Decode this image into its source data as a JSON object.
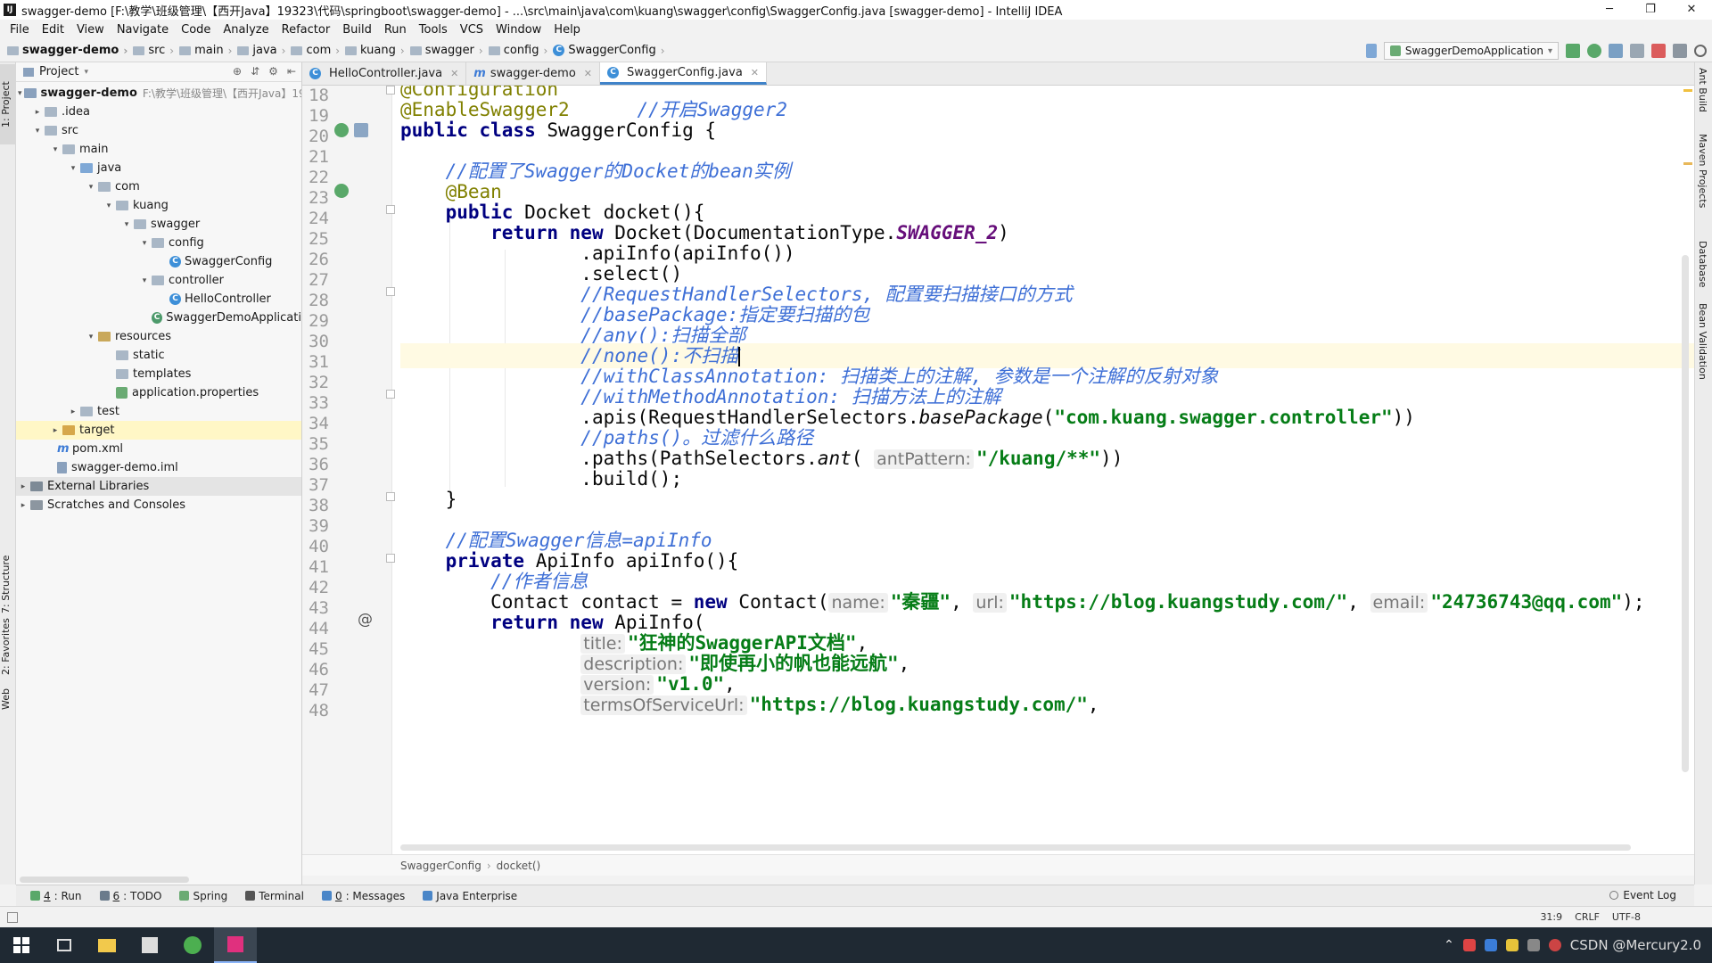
{
  "window": {
    "title": "swagger-demo [F:\\教学\\班级管理\\【西开Java】19323\\代码\\springboot\\swagger-demo] - ...\\src\\main\\java\\com\\kuang\\swagger\\config\\SwaggerConfig.java [swagger-demo] - IntelliJ IDEA",
    "minimize": "─",
    "maximize": "❐",
    "close": "✕"
  },
  "menu": [
    "File",
    "Edit",
    "View",
    "Navigate",
    "Code",
    "Analyze",
    "Refactor",
    "Build",
    "Run",
    "Tools",
    "VCS",
    "Window",
    "Help"
  ],
  "breadcrumbs": [
    "swagger-demo",
    "src",
    "main",
    "java",
    "com",
    "kuang",
    "swagger",
    "config",
    "SwaggerConfig"
  ],
  "run_config": "SwaggerDemoApplication",
  "project_panel": {
    "title": "Project",
    "tree": [
      {
        "label": "swagger-demo",
        "extra": "F:\\教学\\班级管理\\【西开Java】19",
        "arrow": "▾"
      },
      {
        "label": ".idea",
        "arrow": "▸"
      },
      {
        "label": "src",
        "arrow": "▾"
      },
      {
        "label": "main",
        "arrow": "▾"
      },
      {
        "label": "java",
        "arrow": "▾"
      },
      {
        "label": "com",
        "arrow": "▾"
      },
      {
        "label": "kuang",
        "arrow": "▾"
      },
      {
        "label": "swagger",
        "arrow": "▾"
      },
      {
        "label": "config",
        "arrow": "▾"
      },
      {
        "label": "SwaggerConfig",
        "arrow": ""
      },
      {
        "label": "controller",
        "arrow": "▾"
      },
      {
        "label": "HelloController",
        "arrow": ""
      },
      {
        "label": "SwaggerDemoApplicati",
        "arrow": ""
      },
      {
        "label": "resources",
        "arrow": "▾"
      },
      {
        "label": "static",
        "arrow": ""
      },
      {
        "label": "templates",
        "arrow": ""
      },
      {
        "label": "application.properties",
        "arrow": ""
      },
      {
        "label": "test",
        "arrow": "▸"
      },
      {
        "label": "target",
        "arrow": "▸"
      },
      {
        "label": "pom.xml",
        "arrow": ""
      },
      {
        "label": "swagger-demo.iml",
        "arrow": ""
      },
      {
        "label": "External Libraries",
        "arrow": "▸"
      },
      {
        "label": "Scratches and Consoles",
        "arrow": "▸"
      }
    ]
  },
  "tabs": [
    "HelloController.java",
    "swagger-demo",
    "SwaggerConfig.java"
  ],
  "editor": {
    "line_numbers": [
      "18",
      "19",
      "20",
      "21",
      "22",
      "23",
      "24",
      "25",
      "26",
      "27",
      "28",
      "29",
      "30",
      "31",
      "32",
      "33",
      "34",
      "35",
      "36",
      "37",
      "38",
      "39",
      "40",
      "41",
      "42",
      "43",
      "44",
      "45",
      "46",
      "47",
      "48"
    ],
    "code": {
      "l18": "@Configuration",
      "l19a": "@EnableSwagger2",
      "l19b": "//开启Swagger2",
      "l20a": "public class ",
      "l20b": "SwaggerConfig {",
      "l22": "//配置了Swagger的Docket的bean实例",
      "l23": "@Bean",
      "l24a": "public ",
      "l24b": "Docket docket(){",
      "l25a": "return new ",
      "l25b": "Docket(DocumentationType.",
      "l25c": "SWAGGER_2",
      "l25d": ")",
      "l26": ".apiInfo(apiInfo())",
      "l27": ".select()",
      "l28": "//RequestHandlerSelectors, 配置要扫描接口的方式",
      "l29": "//basePackage:指定要扫描的包",
      "l30": "//any():扫描全部",
      "l31": "//none():不扫描",
      "l32": "//withClassAnnotation: 扫描类上的注解, 参数是一个注解的反射对象",
      "l33": "//withMethodAnnotation: 扫描方法上的注解",
      "l34a": ".apis(RequestHandlerSelectors.",
      "l34b": "basePackage",
      "l34c": "(",
      "l34d": "\"com.kuang.swagger.controller\"",
      "l34e": "))",
      "l35": "//paths()。过滤什么路径",
      "l36a": ".paths(PathSelectors.",
      "l36b": "ant",
      "l36c": "(",
      "l36hint": "antPattern:",
      "l36d": "\"/kuang/**\"",
      "l36e": "))",
      "l37": ".build();",
      "l38": "}",
      "l40": "//配置Swagger信息=apiInfo",
      "l41a": "private ",
      "l41b": "ApiInfo apiInfo(){",
      "l42": "//作者信息",
      "l43a": "Contact contact = ",
      "l43b": "new ",
      "l43c": "Contact(",
      "l43h1": "name:",
      "l43s1": "\"秦疆\"",
      "l43h2": "url:",
      "l43s2": "\"https://blog.kuangstudy.com/\"",
      "l43h3": "email:",
      "l43s3": "\"24736743@qq.com\"",
      "l43e": ");",
      "l44a": "return new ",
      "l44b": "ApiInfo(",
      "l45h": "title:",
      "l45s": "\"狂神的SwaggerAPI文档\"",
      "l46h": "description:",
      "l46s": "\"即使再小的帆也能远航\"",
      "l47h": "version:",
      "l47s": "\"v1.0\"",
      "l48h": "termsOfServiceUrl:",
      "l48s": "\"https://blog.kuangstudy.com/\""
    }
  },
  "editor_breadcrumb": [
    "SwaggerConfig",
    "docket()"
  ],
  "tool_windows": [
    {
      "num": "4",
      "label": ": Run",
      "color": "#59a869"
    },
    {
      "num": "6",
      "label": ": TODO",
      "color": "#6b7b8c"
    },
    {
      "num": "",
      "label": "Spring",
      "color": "#6aab73"
    },
    {
      "num": "",
      "label": "Terminal",
      "color": "#555555"
    },
    {
      "num": "0",
      "label": ": Messages",
      "color": "#4a86c8"
    },
    {
      "num": "",
      "label": "Java Enterprise",
      "color": "#4a86c8"
    }
  ],
  "event_log": "Event Log",
  "left_strip": [
    "1: Project",
    "7: Structure",
    "2: Favorites",
    "Web"
  ],
  "right_strip": [
    "Ant Build",
    "Maven Projects",
    "Database",
    "Bean Validation"
  ],
  "status": {
    "position": "31:9",
    "line_sep": "CRLF",
    "encoding": "UTF-8"
  },
  "tray": {
    "watermark": "CSDN @Mercury2.0"
  },
  "colors": {
    "keyword": "#000080",
    "comment": "#3e6fd6",
    "string": "#067d17",
    "annotation": "#808000",
    "static_field": "#660e7a",
    "accent": "#4083c9"
  }
}
